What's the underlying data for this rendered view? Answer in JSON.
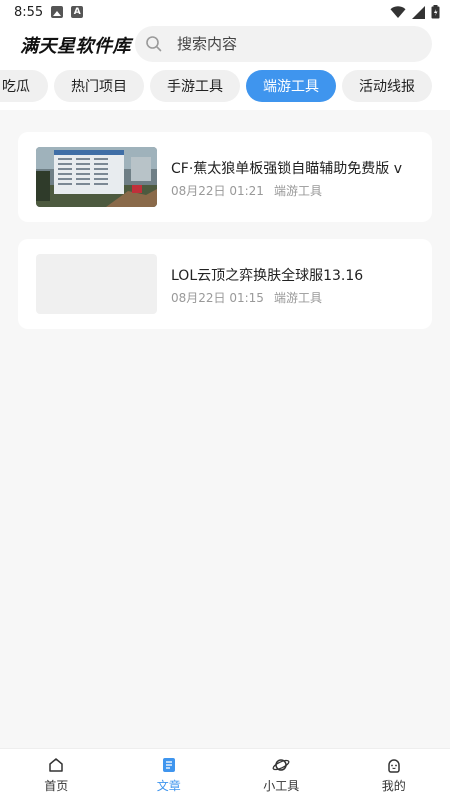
{
  "status_bar": {
    "time": "8:55",
    "icons": [
      "image-icon",
      "a-icon",
      "wifi-icon",
      "signal-icon",
      "battery-icon"
    ]
  },
  "header": {
    "app_title": "满天星软件库",
    "search": {
      "placeholder": "搜索内容",
      "value": ""
    }
  },
  "tabs": [
    {
      "label": "吃瓜",
      "active": false
    },
    {
      "label": "热门项目",
      "active": false
    },
    {
      "label": "手游工具",
      "active": false
    },
    {
      "label": "端游工具",
      "active": true
    },
    {
      "label": "活动线报",
      "active": false
    }
  ],
  "articles": [
    {
      "title": "CF·蕉太狼单板强锁自瞄辅助免费版 v",
      "date": "08月22日 01:21",
      "category": "端游工具",
      "has_image": true
    },
    {
      "title": "LOL云顶之弈换肤全球服13.16",
      "date": "08月22日 01:15",
      "category": "端游工具",
      "has_image": false
    }
  ],
  "bottom_nav": [
    {
      "label": "首页",
      "icon": "home-icon",
      "active": false
    },
    {
      "label": "文章",
      "icon": "article-icon",
      "active": true
    },
    {
      "label": "小工具",
      "icon": "planet-icon",
      "active": false
    },
    {
      "label": "我的",
      "icon": "profile-icon",
      "active": false
    }
  ],
  "colors": {
    "accent": "#3f95ee",
    "background": "#f7f7f7",
    "card": "#ffffff",
    "muted_text": "#999999"
  }
}
